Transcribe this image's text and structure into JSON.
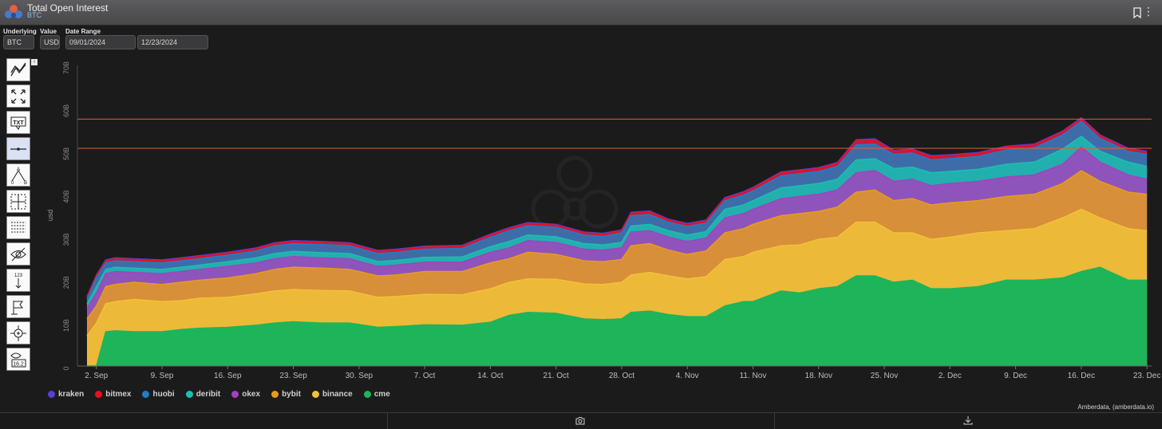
{
  "header": {
    "title": "Total Open Interest",
    "subtitle": "BTC"
  },
  "controls": {
    "underlying_label": "Underlying",
    "underlying_value": "BTC",
    "value_label": "Value",
    "value_value": "USD",
    "date_range_label": "Date Range",
    "date_start": "09/01/2024",
    "date_end": "12/23/2024"
  },
  "toolbar_icons": [
    "trend-line-icon",
    "fullscreen-icon",
    "text-annotation-icon",
    "horizontal-line-icon",
    "triangle-pattern-icon",
    "crosshair-icon",
    "fibonacci-grid-icon",
    "hide-icon",
    "price-label-icon",
    "flag-icon",
    "zoom-icon",
    "value-eye-icon"
  ],
  "credit": "Amberdata, (amberdata.io)",
  "chart_data": {
    "type": "area",
    "stacked": true,
    "ylabel": "usd",
    "ylim": [
      0,
      70
    ],
    "y_ticks": [
      "0",
      "10B",
      "20B",
      "30B",
      "40B",
      "50B",
      "60B",
      "70B"
    ],
    "grid": false,
    "legend_position": "bottom-left",
    "horizontal_lines": [
      57.5,
      50.7
    ],
    "x_tick_labels": [
      "2. Sep",
      "9. Sep",
      "16. Sep",
      "23. Sep",
      "30. Sep",
      "7. Oct",
      "14. Oct",
      "21. Oct",
      "28. Oct",
      "4. Nov",
      "11. Nov",
      "18. Nov",
      "25. Nov",
      "2. Dec",
      "9. Dec",
      "16. Dec",
      "23. Dec"
    ],
    "x_tick_days": [
      1,
      8,
      15,
      22,
      29,
      36,
      43,
      50,
      57,
      64,
      71,
      78,
      85,
      92,
      99,
      106,
      113
    ],
    "x_range_days": [
      0,
      113.5
    ],
    "series_order_bottom_to_top": [
      "cme",
      "binance",
      "bybit",
      "okex",
      "deribit",
      "huobi",
      "bitmex",
      "kraken"
    ],
    "colors": {
      "kraken": "#5a3fd6",
      "bitmex": "#e8101e",
      "huobi": "#1f7fc2",
      "deribit": "#1cbfb0",
      "okex": "#a63fbd",
      "bybit": "#e89c1c",
      "binance": "#f2c238",
      "cme": "#1db45a"
    },
    "legend": [
      "kraken",
      "bitmex",
      "huobi",
      "deribit",
      "okex",
      "bybit",
      "binance",
      "cme"
    ],
    "cumulative_tops": {
      "days": [
        0,
        1,
        2,
        3,
        5,
        8,
        10,
        12,
        15,
        18,
        20,
        22,
        25,
        28,
        31,
        33,
        36,
        40,
        43,
        45,
        47,
        50,
        53,
        55,
        57,
        58,
        60,
        62,
        64,
        66,
        68,
        70,
        71,
        74,
        76,
        78,
        80,
        82,
        84,
        86,
        88,
        90,
        92,
        95,
        98,
        101,
        104,
        106,
        108,
        111,
        113
      ],
      "cme": [
        0,
        0,
        8,
        8.2,
        8,
        8,
        8.5,
        8.8,
        9,
        9.5,
        10,
        10.3,
        10,
        10,
        9,
        9.2,
        9.6,
        9.5,
        10.2,
        11.8,
        12.5,
        12.3,
        11,
        10.8,
        11,
        12.5,
        12.8,
        12,
        11.5,
        11.5,
        14,
        15,
        15,
        17.5,
        17,
        18,
        18.5,
        21,
        21,
        19.5,
        20,
        18,
        18,
        18.5,
        20,
        20,
        20.5,
        22,
        23,
        20,
        20
      ],
      "binance": [
        7,
        10,
        14.5,
        15,
        15.5,
        15,
        15.2,
        15.8,
        16,
        16.8,
        17.5,
        17.8,
        17.6,
        17.5,
        16,
        16.2,
        16.7,
        16.6,
        18,
        19.5,
        20.3,
        20.2,
        19.1,
        19,
        19.5,
        21.2,
        21.8,
        21,
        20.3,
        20.8,
        24.8,
        25.5,
        26.5,
        28,
        28.2,
        29.5,
        30,
        33.5,
        33.5,
        31,
        31,
        29.5,
        30,
        31,
        31.5,
        32,
        34.5,
        36.5,
        34.5,
        32,
        31.5
      ],
      "bybit": [
        11,
        14,
        18.5,
        19,
        19.5,
        19,
        19.5,
        20,
        20.5,
        21.5,
        22.5,
        23,
        22.8,
        22.5,
        21,
        21.2,
        22,
        22,
        24,
        25,
        26.5,
        26,
        24.5,
        24.3,
        24.8,
        28,
        28.5,
        27,
        26,
        26.8,
        31,
        32,
        33,
        35,
        35.5,
        36,
        37,
        40.5,
        41,
        38.5,
        39,
        37.5,
        38,
        38.5,
        39.5,
        40,
        42.5,
        45.5,
        43,
        40.5,
        40
      ],
      "okex": [
        13.5,
        17,
        21.5,
        22,
        21.8,
        21.5,
        22,
        22.5,
        23.2,
        24,
        25,
        25.5,
        25.2,
        25,
        23.2,
        23.5,
        24.2,
        24.2,
        26.5,
        27.5,
        29.2,
        28.8,
        27.2,
        27,
        27.5,
        31.2,
        31.5,
        30,
        29,
        29.8,
        34.5,
        35.5,
        36.5,
        39,
        39.5,
        40,
        41,
        45,
        45.5,
        43,
        43.5,
        42,
        42.5,
        43,
        44,
        44.5,
        47,
        51,
        47.5,
        44.5,
        43.5
      ],
      "deribit": [
        14.5,
        18.5,
        22.5,
        23,
        22.8,
        22.5,
        23,
        23.5,
        24.3,
        25.2,
        26.2,
        26.7,
        26.4,
        26.2,
        24.3,
        24.6,
        25.3,
        25.4,
        27.8,
        29,
        30.5,
        30.1,
        28.5,
        28.2,
        28.8,
        32.6,
        33,
        31.5,
        30.5,
        31.3,
        36.5,
        37.5,
        38.5,
        41.5,
        42,
        42.5,
        43.5,
        48,
        48.3,
        46,
        46.3,
        45,
        45.3,
        45.8,
        47,
        47.5,
        50.5,
        53.5,
        50,
        47.5,
        46.5
      ],
      "huobi": [
        15.5,
        20.5,
        24,
        24.5,
        24.3,
        24,
        24.5,
        25,
        25.8,
        26.8,
        28,
        28.5,
        28.3,
        28,
        26.2,
        26.5,
        27.2,
        27.4,
        30,
        31.5,
        32.7,
        32.3,
        30.5,
        30.2,
        31,
        35,
        35.3,
        33.5,
        32.5,
        33.3,
        38.5,
        39.8,
        40.8,
        44.3,
        44.8,
        45.3,
        46.5,
        51.5,
        51.7,
        49.3,
        49.6,
        48,
        48.3,
        48.8,
        50.3,
        50.8,
        53.8,
        57,
        53,
        50,
        49.3
      ],
      "bitmex": [
        16,
        21,
        24.5,
        25,
        24.8,
        24.5,
        25,
        25.5,
        26.3,
        27.3,
        28.5,
        29,
        28.8,
        28.5,
        26.7,
        27,
        27.7,
        27.9,
        30.5,
        32,
        33.2,
        32.8,
        31,
        30.7,
        31.5,
        35.6,
        35.9,
        34,
        33,
        33.8,
        39,
        40.4,
        41.4,
        45,
        45.5,
        46,
        47.2,
        52.5,
        52.7,
        50,
        50.3,
        48.8,
        49,
        49.5,
        51,
        51.5,
        54.5,
        57.6,
        53.6,
        50.5,
        49.8
      ],
      "kraken": [
        16.2,
        21.2,
        24.7,
        25.2,
        25,
        24.7,
        25.2,
        25.7,
        26.5,
        27.5,
        28.7,
        29.2,
        29,
        28.7,
        26.9,
        27.2,
        27.9,
        28.1,
        30.7,
        32.2,
        33.4,
        33,
        31.2,
        30.9,
        31.7,
        35.8,
        36.1,
        34.2,
        33.2,
        34,
        39.2,
        40.6,
        41.6,
        45.2,
        45.7,
        46.2,
        47.4,
        52.7,
        52.9,
        50.2,
        50.5,
        49,
        49.2,
        49.7,
        51.2,
        51.7,
        54.7,
        57.8,
        53.8,
        50.7,
        50
      ]
    }
  }
}
